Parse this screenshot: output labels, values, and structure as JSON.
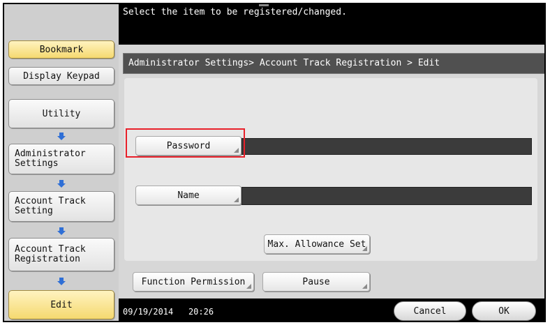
{
  "top_message": "Select the item to be registered/changed.",
  "breadcrumb": "Administrator Settings> Account Track Registration > Edit",
  "left_panel": {
    "bookmark": "Bookmark",
    "display_keypad": "Display Keypad",
    "utility": "Utility",
    "administrator_settings": "Administrator Settings",
    "account_track_setting": "Account Track Setting",
    "account_track_registration": "Account Track Registration",
    "edit": "Edit"
  },
  "fields": {
    "password_label": "Password",
    "name_label": "Name"
  },
  "buttons": {
    "max_allowance_set": "Max. Allowance Set",
    "function_permission": "Function Permission",
    "pause": "Pause",
    "cancel": "Cancel",
    "ok": "OK"
  },
  "status": {
    "date": "09/19/2014",
    "time": "20:26"
  },
  "colors": {
    "highlight": "#e8202a",
    "arrow": "#2f6fd6",
    "bookmark_bg": "#f5d970"
  }
}
